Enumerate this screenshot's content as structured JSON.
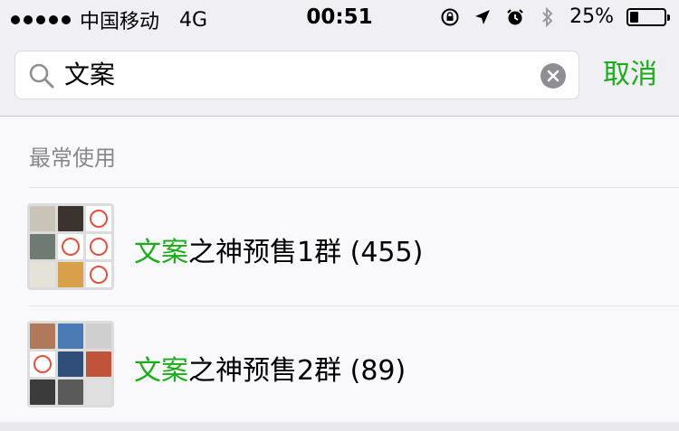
{
  "status_bar": {
    "carrier": "中国移动",
    "network": "4G",
    "time": "00:51",
    "battery_percent": "25%",
    "battery_level": 0.25
  },
  "search": {
    "query": "文案",
    "cancel_label": "取消"
  },
  "section": {
    "header": "最常使用",
    "items": [
      {
        "highlight": "文案",
        "rest": "之神预售1群 (455)",
        "avatar_tiles": [
          "#c9c3b8",
          "#3a3330",
          "ring",
          "#6f7a72",
          "ring",
          "ring",
          "#e7e2d8",
          "#d9a04a",
          "ring"
        ]
      },
      {
        "highlight": "文案",
        "rest": "之神预售2群 (89)",
        "avatar_tiles": [
          "#b07a5a",
          "#4b7bb5",
          "#cfcfcf",
          "ring",
          "#2f4f7a",
          "#c0533b",
          "#3b3b3b",
          "#5a5a5a",
          "#e0e0e0"
        ]
      }
    ]
  },
  "colors": {
    "accent_green": "#1aad19",
    "ring_red": "#e84d3d"
  },
  "icons": [
    "signal-dots",
    "lock-rotation-icon",
    "location-arrow-icon",
    "alarm-icon",
    "bluetooth-icon",
    "battery-icon",
    "search-icon",
    "clear-icon"
  ]
}
